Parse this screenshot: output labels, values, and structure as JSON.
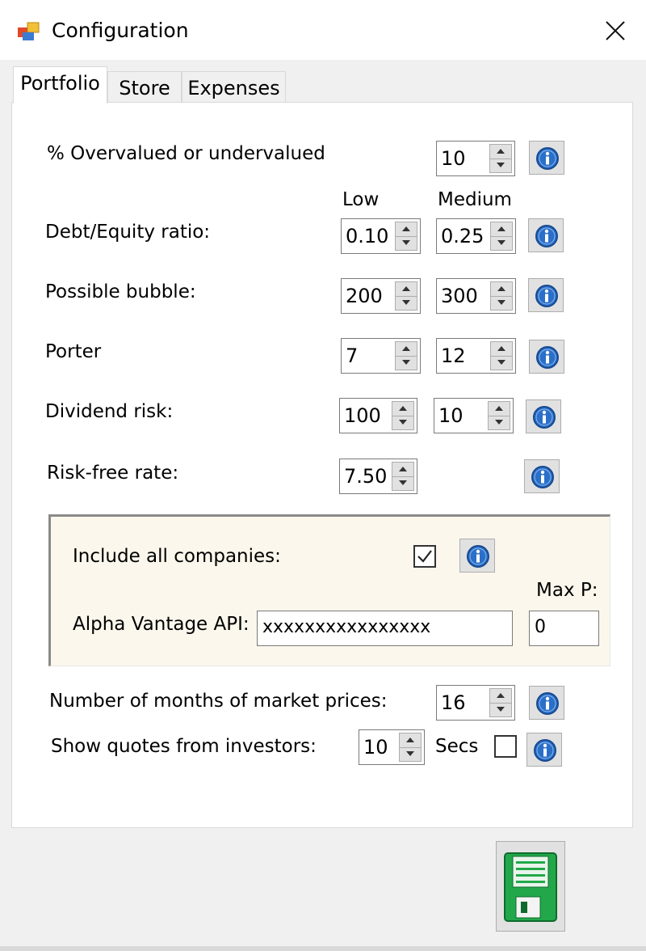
{
  "window": {
    "title": "Configuration"
  },
  "tabs": [
    {
      "label": "Portfolio",
      "active": true
    },
    {
      "label": "Store",
      "active": false
    },
    {
      "label": "Expenses",
      "active": false
    }
  ],
  "portfolio": {
    "overvalued": {
      "label": "% Overvalued or undervalued",
      "value": "10"
    },
    "headers": {
      "low": "Low",
      "medium": "Medium"
    },
    "debt_equity": {
      "label": "Debt/Equity ratio:",
      "low": "0.10",
      "medium": "0.25"
    },
    "bubble": {
      "label": "Possible bubble:",
      "low": "200",
      "medium": "300"
    },
    "porter": {
      "label": "Porter",
      "low": "7",
      "medium": "12"
    },
    "dividend": {
      "label": "Dividend risk:",
      "low": "100",
      "medium": "10"
    },
    "risk_free": {
      "label": "Risk-free rate:",
      "value": "7.50"
    },
    "group": {
      "include_all": {
        "label": "Include all companies:",
        "checked": true
      },
      "max_p_label": "Max P:",
      "api": {
        "label": "Alpha Vantage API:",
        "value": "xxxxxxxxxxxxxxxx"
      },
      "max_p_value": "0"
    },
    "months": {
      "label": "Number of months of market prices:",
      "value": "16"
    },
    "quotes": {
      "label": "Show quotes from investors:",
      "value": "10",
      "unit": "Secs",
      "checked": false
    }
  },
  "icons": {
    "info": "info-icon",
    "save": "floppy-disk-icon",
    "close": "close-icon",
    "app": "app-window-icon"
  },
  "colors": {
    "info_blue": "#2a6fc9",
    "floppy_green": "#22a84a",
    "group_bg": "#fbf7ec"
  }
}
